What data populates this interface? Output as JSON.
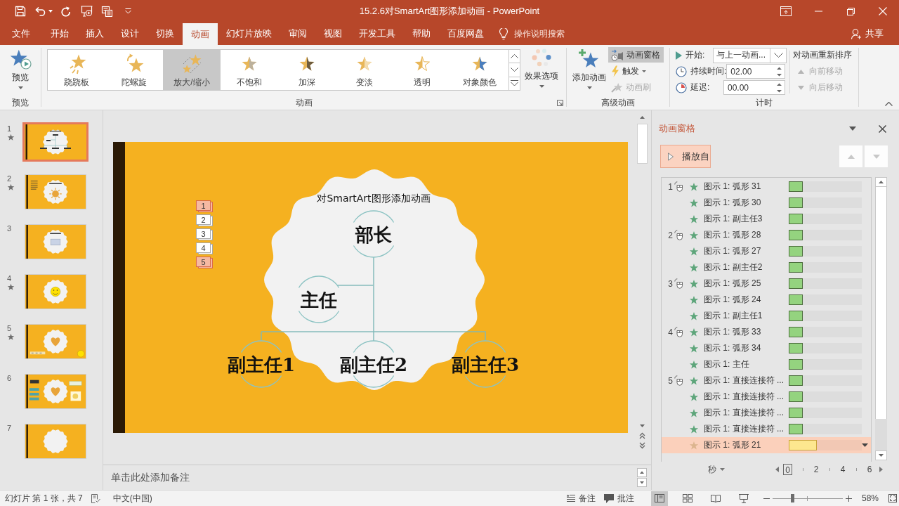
{
  "title_bar": {
    "title": "15.2.6对SmartArt图形添加动画 - PowerPoint"
  },
  "menu": {
    "tabs": [
      {
        "label": "文件",
        "selected": false
      },
      {
        "label": "开始",
        "selected": false
      },
      {
        "label": "插入",
        "selected": false
      },
      {
        "label": "设计",
        "selected": false
      },
      {
        "label": "切换",
        "selected": false
      },
      {
        "label": "动画",
        "selected": true
      },
      {
        "label": "幻灯片放映",
        "selected": false
      },
      {
        "label": "审阅",
        "selected": false
      },
      {
        "label": "视图",
        "selected": false
      },
      {
        "label": "开发工具",
        "selected": false
      },
      {
        "label": "帮助",
        "selected": false
      },
      {
        "label": "百度网盘",
        "selected": false
      }
    ],
    "search": {
      "placeholder": "操作说明搜索"
    },
    "share": "共享"
  },
  "ribbon": {
    "preview": {
      "button": "预览",
      "group": "预览"
    },
    "animation": {
      "group": "动画",
      "effects": [
        {
          "label": "跷跷板",
          "selected": false
        },
        {
          "label": "陀螺旋",
          "selected": false
        },
        {
          "label": "放大/缩小",
          "selected": true
        },
        {
          "label": "不饱和",
          "selected": false
        },
        {
          "label": "加深",
          "selected": false
        },
        {
          "label": "变淡",
          "selected": false
        },
        {
          "label": "透明",
          "selected": false
        },
        {
          "label": "对象颜色",
          "selected": false
        }
      ],
      "effect_options": "效果选项"
    },
    "advanced": {
      "group": "高级动画",
      "add_animation": "添加动画",
      "pane_button": {
        "label": "动画窗格",
        "selected": true
      },
      "trigger": "触发",
      "painter": {
        "label": "动画刷",
        "disabled": true
      }
    },
    "timing": {
      "group": "计时",
      "start": {
        "label": "开始:",
        "value": "与上一动画..."
      },
      "duration": {
        "label": "持续时间:",
        "value": "02.00"
      },
      "delay": {
        "label": "延迟:",
        "value": "00.00"
      },
      "reorder": "对动画重新排序",
      "move_earlier": {
        "label": "向前移动",
        "disabled": true
      },
      "move_later": {
        "label": "向后移动",
        "disabled": true
      }
    }
  },
  "slides": [
    {
      "number": "1",
      "animated": true,
      "selected": true,
      "kind": "orgchart"
    },
    {
      "number": "2",
      "animated": true,
      "selected": false,
      "kind": "sun"
    },
    {
      "number": "3",
      "animated": false,
      "selected": false,
      "kind": "picture"
    },
    {
      "number": "4",
      "animated": true,
      "selected": false,
      "kind": "smiley"
    },
    {
      "number": "5",
      "animated": true,
      "selected": false,
      "kind": "heart"
    },
    {
      "number": "6",
      "animated": false,
      "selected": false,
      "kind": "panels"
    },
    {
      "number": "7",
      "animated": false,
      "selected": false,
      "kind": "blank"
    }
  ],
  "slide": {
    "title": "对SmartArt图形添加动画",
    "org_chart": {
      "root": "部长",
      "assistant": "主任",
      "subordinates": [
        "副主任1",
        "副主任2",
        "副主任3"
      ]
    },
    "animation_tags": [
      {
        "label": "1",
        "selected": true
      },
      {
        "label": "2",
        "selected": false
      },
      {
        "label": "3",
        "selected": false
      },
      {
        "label": "4",
        "selected": false
      },
      {
        "label": "5",
        "selected": true
      }
    ]
  },
  "notes": {
    "placeholder": "单击此处添加备注"
  },
  "animation_pane": {
    "title": "动画窗格",
    "play_button": "播放自",
    "items": [
      {
        "number": "1",
        "label": "图示 1: 弧形 31",
        "selected": false,
        "level": 0.19
      },
      {
        "label": "图示 1: 弧形 30",
        "selected": false,
        "level": 0.19
      },
      {
        "label": "图示 1: 副主任3",
        "selected": false,
        "level": 0.19
      },
      {
        "number": "2",
        "label": "图示 1: 弧形 28",
        "selected": false,
        "level": 0.19
      },
      {
        "label": "图示 1: 弧形 27",
        "selected": false,
        "level": 0.19
      },
      {
        "label": "图示 1: 副主任2",
        "selected": false,
        "level": 0.19
      },
      {
        "number": "3",
        "label": "图示 1: 弧形 25",
        "selected": false,
        "level": 0.19
      },
      {
        "label": "图示 1: 弧形 24",
        "selected": false,
        "level": 0.19
      },
      {
        "label": "图示 1: 副主任1",
        "selected": false,
        "level": 0.19
      },
      {
        "number": "4",
        "label": "图示 1: 弧形 33",
        "selected": false,
        "level": 0.19
      },
      {
        "label": "图示 1: 弧形 34",
        "selected": false,
        "level": 0.19
      },
      {
        "label": "图示 1: 主任",
        "selected": false,
        "level": 0.19
      },
      {
        "number": "5",
        "label": "图示 1: 直接连接符 ...",
        "selected": false,
        "level": 0.19
      },
      {
        "label": "图示 1: 直接连接符 ...",
        "selected": false,
        "level": 0.19
      },
      {
        "label": "图示 1: 直接连接符 ...",
        "selected": false,
        "level": 0.19
      },
      {
        "label": "图示 1: 直接连接符 ...",
        "selected": false,
        "level": 0.19
      },
      {
        "label": "图示 1: 弧形 21",
        "selected": true,
        "level": 0.38
      }
    ],
    "timeline": {
      "unit": "秒",
      "ticks": [
        "0",
        "2",
        "4",
        "6"
      ]
    }
  },
  "status_bar": {
    "slide_info": "幻灯片 第 1 张，共 7",
    "language": "中文(中国)",
    "notes": "备注",
    "comments": "批注",
    "views": [
      {
        "kind": "normal",
        "selected": true
      },
      {
        "kind": "sorter",
        "selected": false
      },
      {
        "kind": "reading",
        "selected": false
      },
      {
        "kind": "slideshow",
        "selected": false
      }
    ],
    "zoom": {
      "level": 0.28,
      "reading": "58%"
    }
  }
}
